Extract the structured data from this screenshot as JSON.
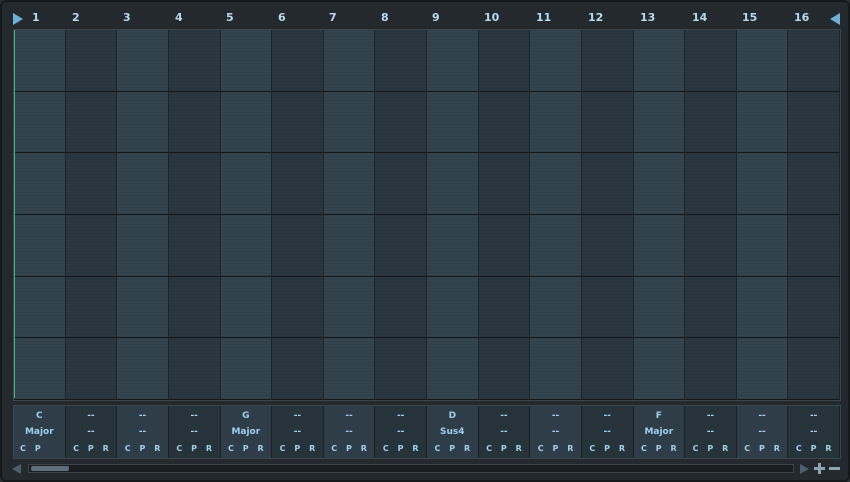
{
  "bars": [
    "1",
    "2",
    "3",
    "4",
    "5",
    "6",
    "7",
    "8",
    "9",
    "10",
    "11",
    "12",
    "13",
    "14",
    "15",
    "16"
  ],
  "rows": 6,
  "chords": [
    {
      "root": "C",
      "type": "Major"
    },
    {
      "root": "--",
      "type": "--"
    },
    {
      "root": "--",
      "type": "--"
    },
    {
      "root": "--",
      "type": "--"
    },
    {
      "root": "G",
      "type": "Major"
    },
    {
      "root": "--",
      "type": "--"
    },
    {
      "root": "--",
      "type": "--"
    },
    {
      "root": "--",
      "type": "--"
    },
    {
      "root": "D",
      "type": "Sus4"
    },
    {
      "root": "--",
      "type": "--"
    },
    {
      "root": "--",
      "type": "--"
    },
    {
      "root": "--",
      "type": "--"
    },
    {
      "root": "F",
      "type": "Major"
    },
    {
      "root": "--",
      "type": "--"
    },
    {
      "root": "--",
      "type": "--"
    },
    {
      "root": "--",
      "type": "--"
    }
  ],
  "cpr_labels": [
    "C",
    "P",
    "R"
  ],
  "first_cell_labels": [
    "C",
    "P"
  ],
  "colors": {
    "accent": "#6fb1d6",
    "playhead": "#2fbf86",
    "chord_text": "#9fd0ee"
  }
}
